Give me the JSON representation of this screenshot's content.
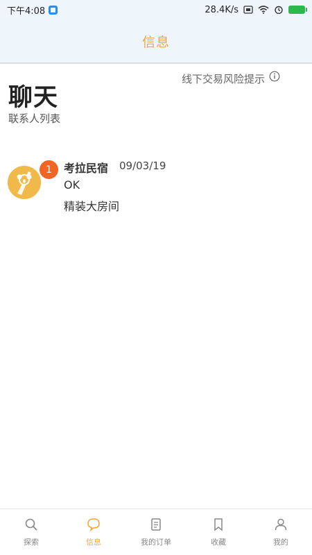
{
  "status_bar": {
    "time": "下午4:08",
    "speed": "28.4K/s"
  },
  "app_bar": {
    "title": "信息"
  },
  "header": {
    "risk_tip": "线下交易风险提示",
    "title": "聊天",
    "subtitle": "联系人列表"
  },
  "chats": [
    {
      "name": "考拉民宿",
      "date": "09/03/19",
      "unread": "1",
      "message": "OK",
      "room": "精装大房间"
    }
  ],
  "bottom_nav": [
    {
      "label": "探索",
      "icon": "search-icon",
      "active": false
    },
    {
      "label": "信息",
      "icon": "chat-bubble-icon",
      "active": true
    },
    {
      "label": "我的订单",
      "icon": "order-icon",
      "active": false
    },
    {
      "label": "收藏",
      "icon": "bookmark-icon",
      "active": false
    },
    {
      "label": "我的",
      "icon": "profile-icon",
      "active": false
    }
  ],
  "colors": {
    "accent": "#f0a83a",
    "badge": "#f26522",
    "header_bg": "#eef6fc",
    "battery": "#2db84b"
  }
}
